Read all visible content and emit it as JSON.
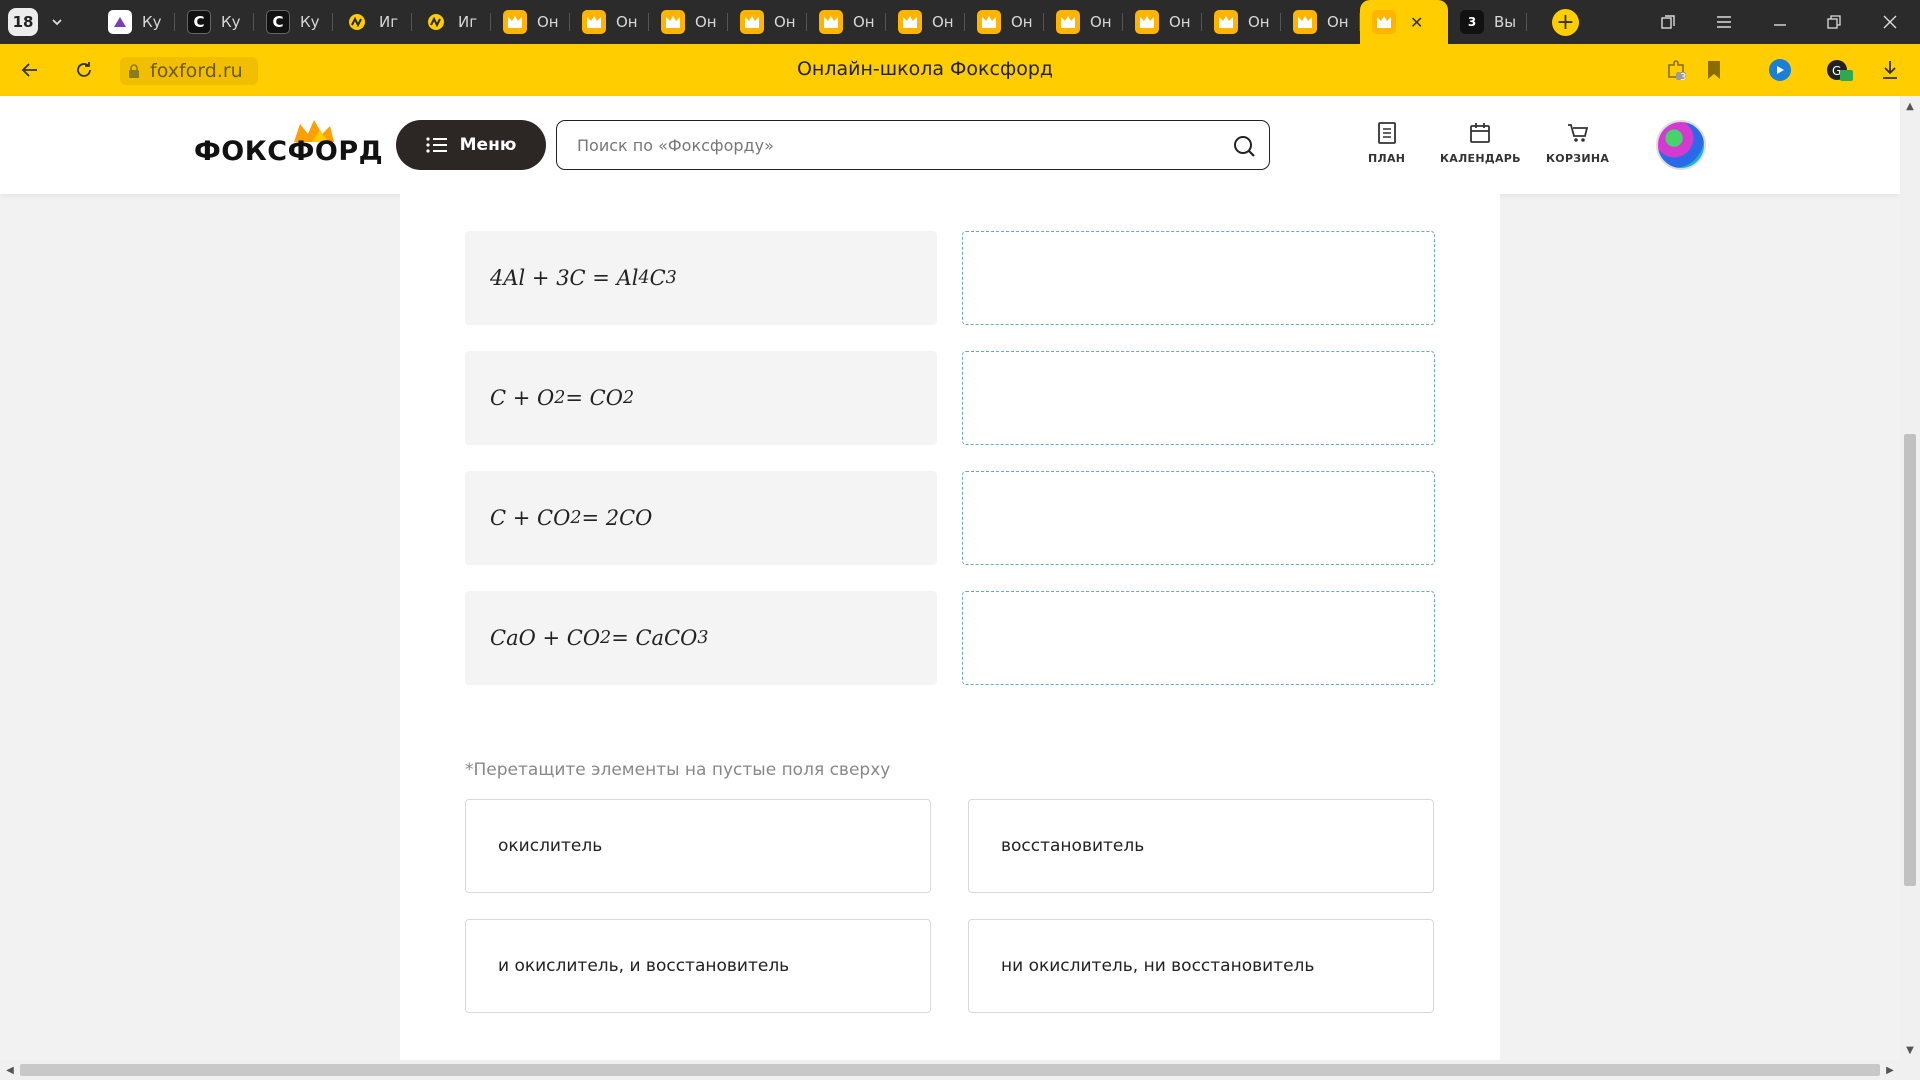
{
  "browser": {
    "tab_count": "18",
    "tabs": [
      {
        "title": "Ку",
        "icon": "app-icon",
        "favicon_text": "",
        "style": "white"
      },
      {
        "title": "Ку",
        "icon": "c-letter-icon",
        "favicon_text": "C",
        "style": "black"
      },
      {
        "title": "Ку",
        "icon": "c-letter-icon",
        "favicon_text": "C",
        "style": "black"
      },
      {
        "title": "Иг",
        "icon": "yellow-logo-icon",
        "favicon_text": "",
        "style": "yellowc"
      },
      {
        "title": "Иг",
        "icon": "yellow-logo-icon",
        "favicon_text": "",
        "style": "yellowc"
      },
      {
        "title": "Он",
        "icon": "foxford-icon",
        "favicon_text": "",
        "style": "fox"
      },
      {
        "title": "Он",
        "icon": "foxford-icon",
        "favicon_text": "",
        "style": "fox"
      },
      {
        "title": "Он",
        "icon": "foxford-icon",
        "favicon_text": "",
        "style": "fox"
      },
      {
        "title": "Он",
        "icon": "foxford-icon",
        "favicon_text": "",
        "style": "fox"
      },
      {
        "title": "Он",
        "icon": "foxford-icon",
        "favicon_text": "",
        "style": "fox"
      },
      {
        "title": "Он",
        "icon": "foxford-icon",
        "favicon_text": "",
        "style": "fox"
      },
      {
        "title": "Он",
        "icon": "foxford-icon",
        "favicon_text": "",
        "style": "fox"
      },
      {
        "title": "Он",
        "icon": "foxford-icon",
        "favicon_text": "",
        "style": "fox"
      },
      {
        "title": "Он",
        "icon": "foxford-icon",
        "favicon_text": "",
        "style": "fox"
      },
      {
        "title": "Он",
        "icon": "foxford-icon",
        "favicon_text": "",
        "style": "fox"
      },
      {
        "title": "Он",
        "icon": "foxford-icon",
        "favicon_text": "",
        "style": "fox"
      }
    ],
    "active_tab": {
      "icon": "foxford-icon",
      "close": "✕"
    },
    "last_tab": {
      "title": "Вы",
      "favicon_text": "3",
      "icon": "three-icon"
    },
    "url": "foxford.ru",
    "page_title": "Онлайн-школа Фоксфорд",
    "extension_badge": "3",
    "accent_color": "#ffcd00"
  },
  "site": {
    "logo_text": "ФОКСФОРД",
    "menu_label": "Меню",
    "search_placeholder": "Поиск по «Фоксфорду»",
    "search_value": "",
    "nav": [
      {
        "label": "ПЛАН",
        "icon": "plan-icon"
      },
      {
        "label": "КАЛЕНДАРЬ",
        "icon": "calendar-icon"
      },
      {
        "label": "КОРЗИНА",
        "icon": "cart-icon"
      }
    ]
  },
  "exercise": {
    "reactions": [
      {
        "pre": "4Al + 3C = Al",
        "sub1": "4",
        "mid": "C",
        "sub2": "3",
        "post": ""
      },
      {
        "pre": "C + O",
        "sub1": "2",
        "mid": " = CO",
        "sub2": "2",
        "post": ""
      },
      {
        "pre": "C + CO",
        "sub1": "2",
        "mid": " = 2CO",
        "sub2": "",
        "post": ""
      },
      {
        "pre": "CaO + CO",
        "sub1": "2",
        "mid": " = CaCO",
        "sub2": "3",
        "post": ""
      }
    ],
    "hint": "*Перетащите элементы на пустые поля сверху",
    "options": [
      "окислитель",
      "восстановитель",
      "и окислитель, и восстановитель",
      "ни окислитель, ни восстановитель"
    ]
  }
}
